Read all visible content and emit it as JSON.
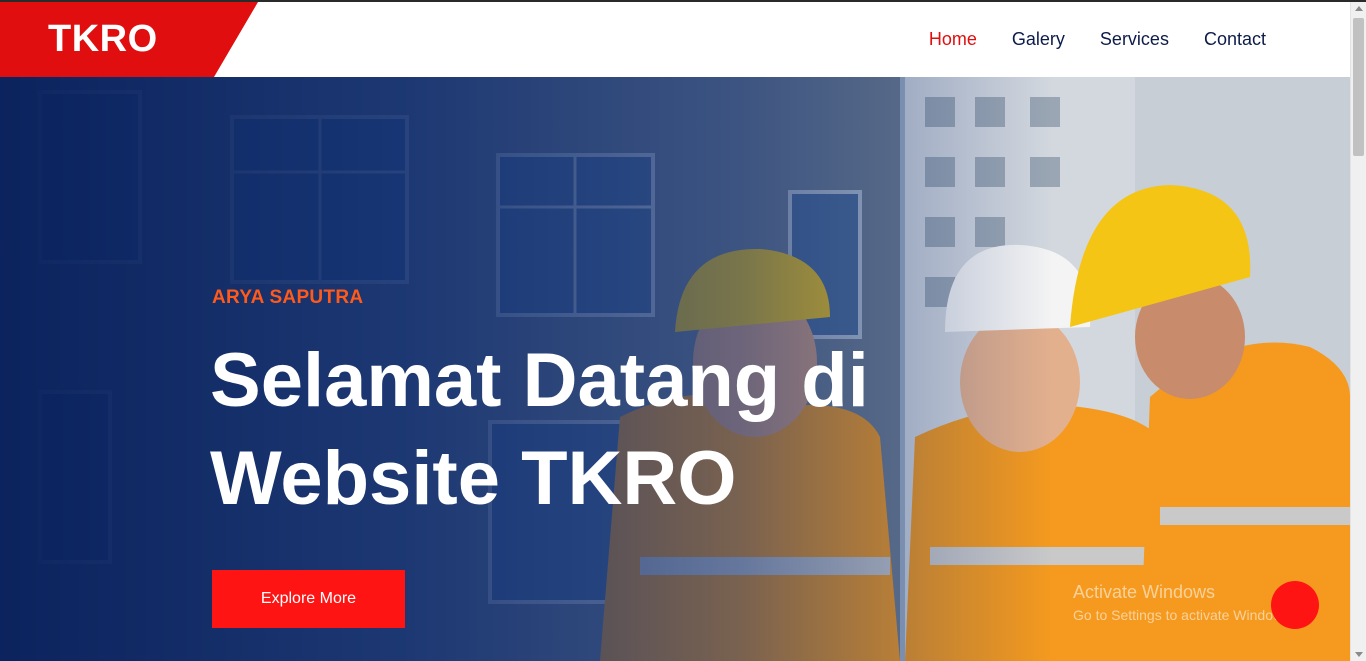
{
  "header": {
    "logo": "TKRO",
    "nav": [
      {
        "label": "Home",
        "active": true
      },
      {
        "label": "Galery",
        "active": false
      },
      {
        "label": "Services",
        "active": false
      },
      {
        "label": "Contact",
        "active": false
      }
    ]
  },
  "hero": {
    "subtitle": "ARYA SAPUTRA",
    "headline_line1": "Selamat Datang di",
    "headline_line2": "Website TKRO",
    "cta_label": "Explore More",
    "background_image": "construction workers in hard hats and safety vests"
  },
  "watermark": {
    "title": "Activate Windows",
    "subtitle": "Go to Settings to activate Windows."
  },
  "colors": {
    "accent_red": "#e00e0e",
    "button_red": "#ff1414",
    "subtitle_orange": "#ff5a1a",
    "nav_text": "#0d1b4a",
    "overlay_navy": "#08205c"
  }
}
